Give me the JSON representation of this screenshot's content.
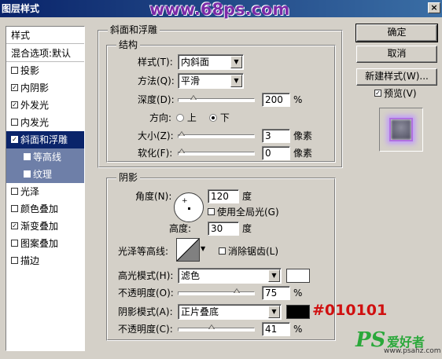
{
  "window": {
    "title": "图层样式",
    "close": "×",
    "watermark": "www.68ps.com"
  },
  "styles": {
    "header": "样式",
    "blend_options": "混合选项:默认",
    "items": [
      {
        "label": "投影",
        "checked": false
      },
      {
        "label": "内阴影",
        "checked": true
      },
      {
        "label": "外发光",
        "checked": true
      },
      {
        "label": "内发光",
        "checked": false
      },
      {
        "label": "斜面和浮雕",
        "checked": true
      },
      {
        "label": "等高线",
        "checked": false
      },
      {
        "label": "纹理",
        "checked": false
      },
      {
        "label": "光泽",
        "checked": false
      },
      {
        "label": "颜色叠加",
        "checked": false
      },
      {
        "label": "渐变叠加",
        "checked": true
      },
      {
        "label": "图案叠加",
        "checked": false
      },
      {
        "label": "描边",
        "checked": false
      }
    ]
  },
  "buttons": {
    "ok": "确定",
    "cancel": "取消",
    "new_style": "新建样式(W)...",
    "preview": "预览(V)",
    "preview_checked": true
  },
  "bevel": {
    "group_title": "斜面和浮雕",
    "structure_title": "结构",
    "style_label": "样式(T):",
    "style_value": "内斜面",
    "technique_label": "方法(Q):",
    "technique_value": "平滑",
    "depth_label": "深度(D):",
    "depth_value": "200",
    "depth_unit": "%",
    "direction_label": "方向:",
    "dir_up": "上",
    "dir_down": "下",
    "direction_selected": "下",
    "size_label": "大小(Z):",
    "size_value": "3",
    "size_unit": "像素",
    "soften_label": "软化(F):",
    "soften_value": "0",
    "soften_unit": "像素"
  },
  "shading": {
    "group_title": "阴影",
    "angle_label": "角度(N):",
    "angle_value": "120",
    "angle_unit": "度",
    "global_light": "使用全局光(G)",
    "global_light_checked": false,
    "altitude_label": "高度:",
    "altitude_value": "30",
    "altitude_unit": "度",
    "gloss_label": "光泽等高线:",
    "antialias": "消除锯齿(L)",
    "antialias_checked": false,
    "highlight_mode_label": "高光模式(H):",
    "highlight_mode_value": "滤色",
    "highlight_color": "#ffffff",
    "highlight_opacity_label": "不透明度(O):",
    "highlight_opacity_value": "75",
    "highlight_opacity_unit": "%",
    "shadow_mode_label": "阴影模式(A):",
    "shadow_mode_value": "正片叠底",
    "shadow_color": "#010101",
    "shadow_opacity_label": "不透明度(C):",
    "shadow_opacity_value": "41",
    "shadow_opacity_unit": "%"
  },
  "annotation": "#010101",
  "logo": {
    "ps": "PS",
    "text": "爱好者",
    "url": "www.psahz.com"
  }
}
